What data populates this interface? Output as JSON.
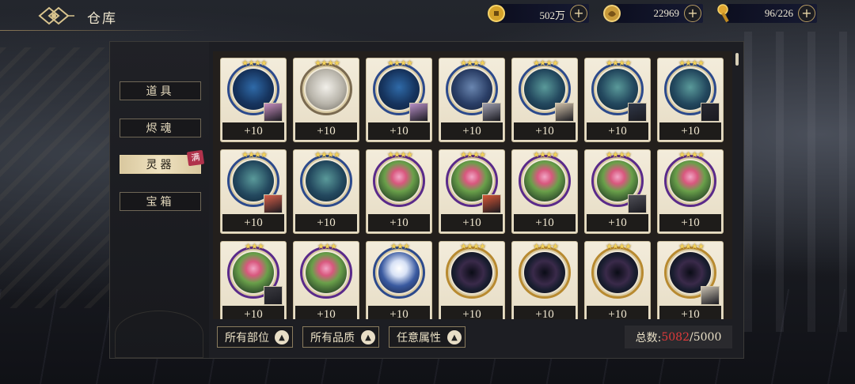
{
  "header": {
    "title": "仓库"
  },
  "resources": [
    {
      "icon": "gold-coin-icon",
      "value": "502万"
    },
    {
      "icon": "dragon-token-icon",
      "value": "22969"
    },
    {
      "icon": "stamina-key-icon",
      "value": "96/226"
    }
  ],
  "sidebar": {
    "items": [
      {
        "label": "道具"
      },
      {
        "label": "烬魂"
      },
      {
        "label": "灵器"
      },
      {
        "label": "宝箱"
      }
    ],
    "active_index": 2,
    "badge": "满"
  },
  "items": [
    {
      "level": "+10",
      "stars": "★★★★",
      "type": "blue-tree",
      "portrait": true,
      "pcolor": "#c890c0"
    },
    {
      "level": "+10",
      "stars": "★★★★",
      "type": "white-beast",
      "portrait": false
    },
    {
      "level": "+10",
      "stars": "★★★★",
      "type": "blue-tree",
      "portrait": true,
      "pcolor": "#b890c8"
    },
    {
      "level": "+10",
      "stars": "★★★★",
      "type": "blue-knight",
      "portrait": true,
      "pcolor": "#a0a0b0"
    },
    {
      "level": "+10",
      "stars": "★★★★",
      "type": "blue-dragon",
      "portrait": true,
      "pcolor": "#d0c0a8"
    },
    {
      "level": "+10",
      "stars": "★★★★",
      "type": "blue-dragon",
      "portrait": true,
      "pcolor": "#303848"
    },
    {
      "level": "+10",
      "stars": "★★★★",
      "type": "blue-dragon",
      "portrait": true,
      "pcolor": "#282830"
    },
    {
      "level": "+10",
      "stars": "★★★★",
      "type": "blue-dragon",
      "portrait": true,
      "pcolor": "#d8604a"
    },
    {
      "level": "+10",
      "stars": "★★★★",
      "type": "blue-dragon",
      "portrait": false
    },
    {
      "level": "+10",
      "stars": "★★★★",
      "type": "lotus-pink",
      "portrait": false
    },
    {
      "level": "+10",
      "stars": "★★★★",
      "type": "lotus-pink",
      "portrait": true,
      "pcolor": "#d85838"
    },
    {
      "level": "+10",
      "stars": "★★★★",
      "type": "lotus-pink",
      "portrait": false
    },
    {
      "level": "+10",
      "stars": "★★★★",
      "type": "lotus-pink",
      "portrait": true,
      "pcolor": "#505058"
    },
    {
      "level": "+10",
      "stars": "★★★★",
      "type": "lotus-pink",
      "portrait": false
    },
    {
      "level": "+10",
      "stars": "★★★",
      "type": "lotus-pink",
      "portrait": true,
      "pcolor": "#3a3a40"
    },
    {
      "level": "+10",
      "stars": "★★★",
      "type": "lotus-pink",
      "portrait": false
    },
    {
      "level": "+10",
      "stars": "★★★",
      "type": "lotus-white",
      "portrait": false
    },
    {
      "level": "+10",
      "stars": "★★★★",
      "type": "beads",
      "portrait": false
    },
    {
      "level": "+10",
      "stars": "★★★★",
      "type": "beads",
      "portrait": false
    },
    {
      "level": "+10",
      "stars": "★★★★",
      "type": "beads",
      "portrait": false
    },
    {
      "level": "+10",
      "stars": "★★★★",
      "type": "beads",
      "portrait": true,
      "pcolor": "#c8c0b0"
    }
  ],
  "filters": [
    {
      "label": "所有部位"
    },
    {
      "label": "所有品质"
    },
    {
      "label": "任意属性"
    }
  ],
  "total": {
    "label": "总数:",
    "current": "5082",
    "max": "/5000"
  }
}
